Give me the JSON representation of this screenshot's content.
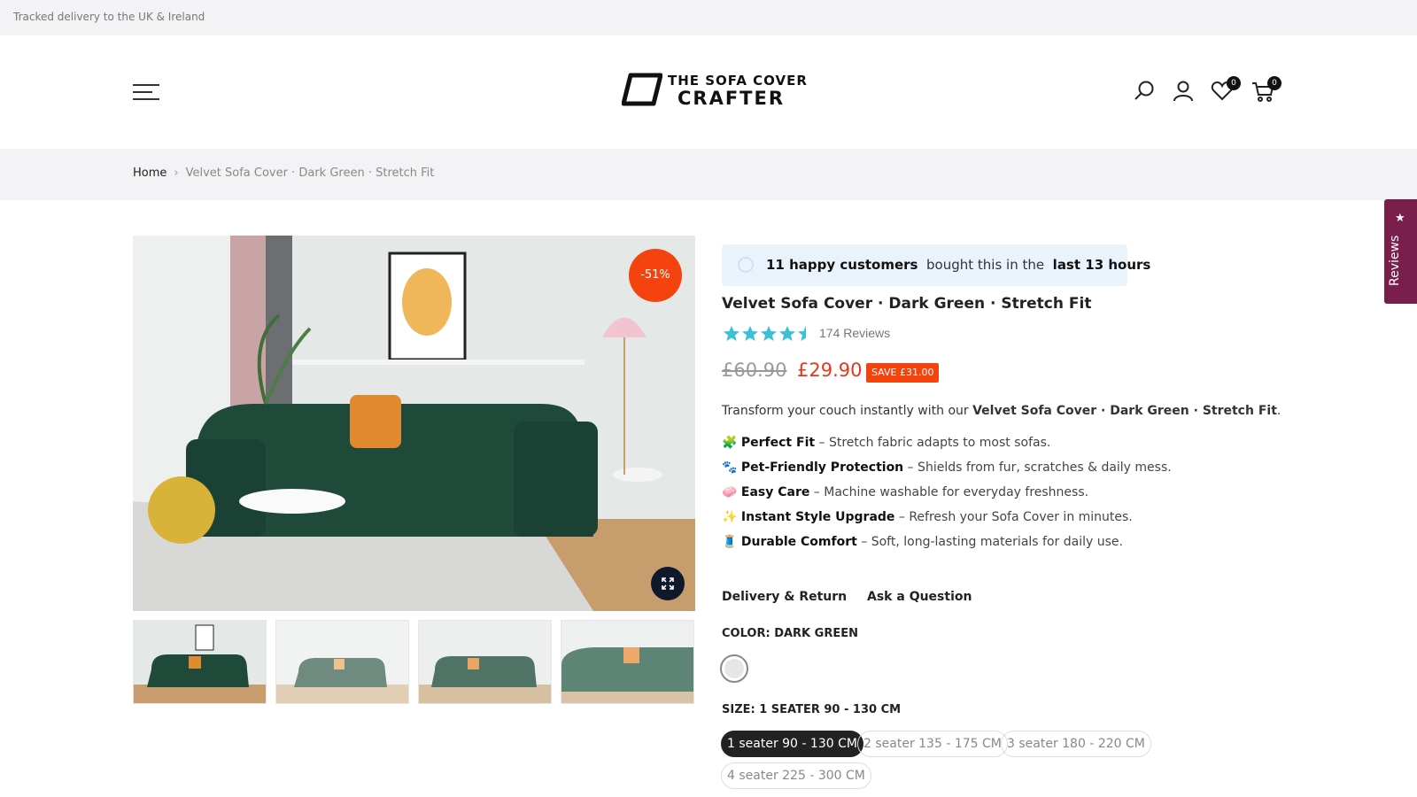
{
  "topbar": {
    "text": "Tracked delivery to the UK & Ireland"
  },
  "header": {
    "logo_line1": "THE SOFA COVER",
    "logo_line2": "CRAFTER",
    "wishlist_count": "0",
    "cart_count": "0",
    "icons": [
      "menu-icon",
      "search-icon",
      "account-icon",
      "wishlist-heart-icon",
      "cart-icon"
    ]
  },
  "breadcrumb": {
    "home": "Home",
    "current": "Velvet Sofa Cover · Dark Green · Stretch Fit"
  },
  "gallery": {
    "discount_badge": "-51%",
    "thumbnail_count": 4
  },
  "social_proof": {
    "count": "11 happy customers",
    "middle": "bought this in the",
    "period": "last 13 hours"
  },
  "product": {
    "title": "Velvet Sofa Cover · Dark Green · Stretch Fit",
    "rating": 4.5,
    "reviews": "174 Reviews",
    "price_old": "£60.90",
    "price_new": "£29.90",
    "save_badge": "SAVE £31.00",
    "desc_prefix": "Transform your couch instantly with our ",
    "desc_strong": "Velvet Sofa Cover · Dark Green · Stretch Fit",
    "desc_suffix": ".",
    "features": [
      {
        "emoji": "🧩",
        "title": "Perfect Fit",
        "text": " – Stretch fabric adapts to most sofas."
      },
      {
        "emoji": "🐾",
        "title": "Pet-Friendly Protection",
        "text": " – Shields from fur, scratches & daily mess."
      },
      {
        "emoji": "🧼",
        "title": "Easy Care",
        "text": " – Machine washable for everyday freshness."
      },
      {
        "emoji": "✨",
        "title": "Instant Style Upgrade",
        "text": " – Refresh your Sofa Cover in minutes."
      },
      {
        "emoji": "🧵",
        "title": "Durable Comfort",
        "text": " – Soft, long-lasting materials for daily use."
      }
    ],
    "tabs": {
      "delivery": "Delivery & Return",
      "ask": "Ask a Question"
    },
    "color_label": "COLOR: DARK GREEN",
    "size_label": "SIZE: 1 SEATER 90 - 130 CM",
    "sizes": [
      "1 seater 90 - 130 CM",
      "2 seater 135 - 175 CM",
      "3 seater 180 - 220 CM",
      "4 seater 225 - 300 CM"
    ]
  },
  "reviews_tab": {
    "label": "Reviews"
  },
  "colors": {
    "accent": "#f5430f",
    "price": "#e8361a",
    "star": "#3cc0d6",
    "reviews_tab": "#7a1f4c",
    "sofa_green": "#1f4a3a"
  }
}
